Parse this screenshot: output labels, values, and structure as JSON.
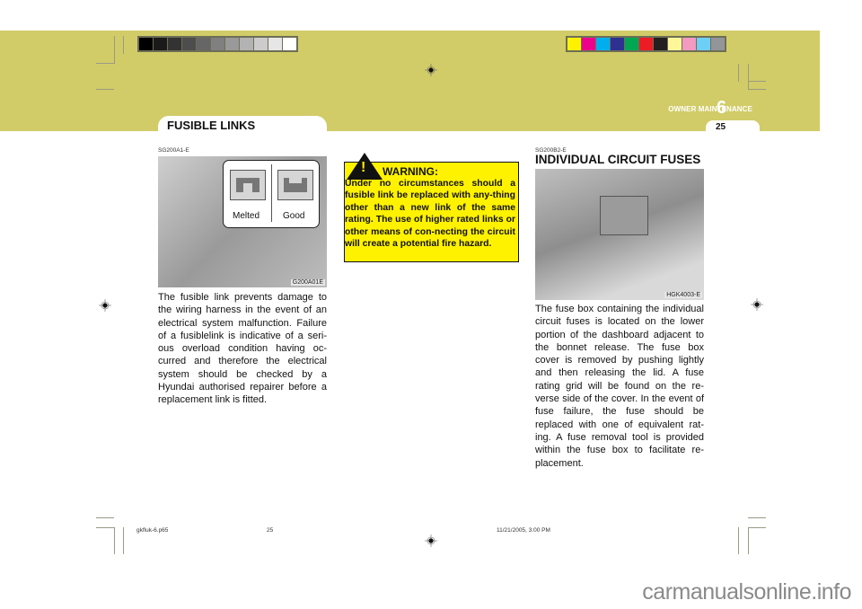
{
  "header": {
    "section_label": "OWNER MAINTENANCE",
    "chapter_number": "6",
    "page_number": "25",
    "grayscale_swatches": [
      "#000000",
      "#1a1a1a",
      "#333333",
      "#4d4d4d",
      "#666666",
      "#808080",
      "#999999",
      "#b3b3b3",
      "#cccccc",
      "#e6e6e6",
      "#ffffff"
    ],
    "color_swatches": [
      "#fff200",
      "#ec008c",
      "#00aeef",
      "#2e3192",
      "#00a651",
      "#ed1c24",
      "#231f20",
      "#fff799",
      "#f49ac1",
      "#6dcff6",
      "#939598"
    ],
    "band_color": "#d1cc68"
  },
  "left_column": {
    "title": "FUSIBLE LINKS",
    "ref_code": "SG200A1-E",
    "figure": {
      "code": "G200A01E",
      "labels": {
        "melted": "Melted",
        "good": "Good"
      }
    },
    "body": "The fusible link prevents damage to the wiring harness in the event of an electrical system malfunction. Failure of a fusiblelink is indicative of a seri-ous overload condition having oc-curred and therefore the electrical system should be checked by a Hyundai authorised repairer before a replacement link is fitted."
  },
  "warning": {
    "symbol": "!",
    "title": "WARNING:",
    "text": "Under no circumstances should a fusible link be replaced with any-thing other than a new link of the same rating. The use of higher rated links or other means of con-necting the circuit will create a potential fire hazard.",
    "color": "#fff200"
  },
  "right_column": {
    "ref_code": "SG200B2-E",
    "title": "INDIVIDUAL CIRCUIT FUSES",
    "figure": {
      "code": "HGK4003-E"
    },
    "body": "The fuse box containing the individual circuit fuses is located on the lower portion of the dashboard adjacent to the bonnet release. The fuse box cover is removed by pushing lightly and then releasing the lid. A fuse rating grid will be found on the re-verse side of the cover. In the event of fuse failure, the fuse should be replaced with one of equivalent rat-ing. A fuse removal tool is provided within the fuse box to facilitate re-placement."
  },
  "footer": {
    "file_name": "gkfluk-6.p65",
    "page": "25",
    "timestamp": "11/21/2005, 3:00 PM"
  },
  "watermark": "carmanualsonline.info"
}
